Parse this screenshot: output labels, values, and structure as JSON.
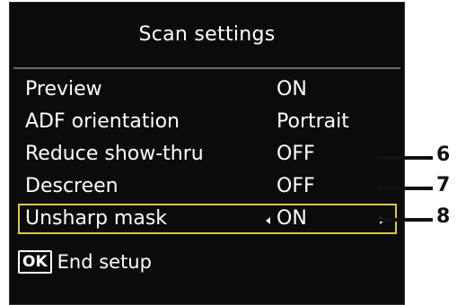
{
  "screen": {
    "title": "Scan settings",
    "menu": [
      {
        "label": "Preview",
        "value": "ON"
      },
      {
        "label": "ADF orientation",
        "value": "Portrait"
      },
      {
        "label": "Reduce show-thru",
        "value": "OFF"
      },
      {
        "label": "Descreen",
        "value": "OFF"
      },
      {
        "label": "Unsharp mask",
        "value": "ON",
        "selected": true
      }
    ],
    "footer": {
      "key": "OK",
      "text": "End setup"
    }
  },
  "callouts": [
    "6",
    "7",
    "8"
  ],
  "colors": {
    "screen_bg": "#0b0b0b",
    "selection": "#d8c84a",
    "text": "#ffffff"
  }
}
